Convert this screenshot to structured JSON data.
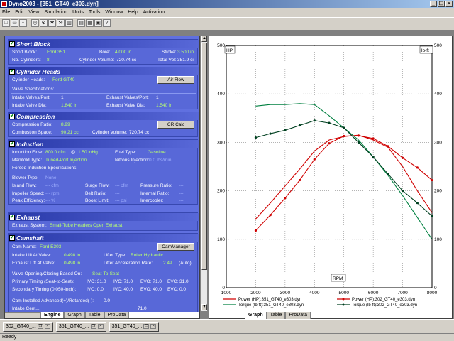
{
  "window": {
    "title": "Dyno2003 - [351_GT40_e303.dyn]"
  },
  "menu": [
    "File",
    "Edit",
    "View",
    "Simulation",
    "Units",
    "Tools",
    "Window",
    "Help",
    "Activation"
  ],
  "toolbar_icons": [
    "new-icon",
    "open-icon",
    "save-icon",
    "sep",
    "wheel-icon",
    "gear-icon",
    "settings-icon",
    "tools-icon",
    "fuel-icon",
    "sep",
    "chart-icon",
    "print-icon",
    "report-icon",
    "help-icon"
  ],
  "short_block": {
    "title": "Short Block",
    "short_block_label": "Short Block:",
    "short_block_value": "Ford 351",
    "bore_label": "Bore:",
    "bore_value": "4.000 in",
    "stroke_label": "Stroke:",
    "stroke_value": "3.500 in",
    "cylinders_label": "No. Cylinders:",
    "cylinders_value": "8",
    "cyl_volume_label": "Cylinder Volume:",
    "cyl_volume_value": "720.74 cc",
    "total_vol_label": "Total Vol:",
    "total_vol_value": "351.9 ci"
  },
  "cylinder_heads": {
    "title": "Cylinder Heads",
    "heads_label": "Cylinder Heads:",
    "heads_value": "Ford GT40",
    "air_flow_button": "Air Flow",
    "valve_spec_label": "Valve Specifications:",
    "intake_valves_label": "Intake Valves/Port:",
    "intake_valves_value": "1",
    "exhaust_valves_label": "Exhaust Valves/Port:",
    "exhaust_valves_value": "1",
    "intake_dia_label": "Intake Valve Dia:",
    "intake_dia_value": "1.840 in",
    "exhaust_dia_label": "Exhaust Valve Dia:",
    "exhaust_dia_value": "1.540 in"
  },
  "compression": {
    "title": "Compression",
    "ratio_label": "Compression Ratio:",
    "ratio_value": "8.99",
    "cr_calc_button": "CR Calc",
    "space_label": "Combustion Space:",
    "space_value": "90.21 cc",
    "cyl_volume_label": "Cylinder Volume:",
    "cyl_volume_value": "720.74 cc"
  },
  "induction": {
    "title": "Induction",
    "flow_label": "Induction Flow:",
    "flow_value": "800.0 cfm",
    "flow_at": "@",
    "flow_hg": "1.50 inHg",
    "fuel_label": "Fuel Type:",
    "fuel_value": "Gasoline",
    "manifold_label": "Manifold Type:",
    "manifold_value": "Tuned-Port Injection",
    "nitrous_label": "Nitrous Injection:",
    "nitrous_value": "0.0 lbs/min",
    "forced_label": "Forced Induction Specifications:",
    "blower_label": "Blower Type:",
    "blower_value": "None",
    "island_label": "Island Flow:",
    "island_value": "--- cfm",
    "surge_label": "Surge Flow:",
    "surge_value": "--- cfm",
    "pressure_label": "Pressure Ratio:",
    "pressure_value": "---",
    "impeller_label": "Impeller Speed:",
    "impeller_value": "--- rpm",
    "belt_label": "Belt Ratio:",
    "belt_value": "---",
    "internal_label": "Internal Ratio:",
    "internal_value": "---",
    "peak_label": "Peak Efficiency:",
    "peak_value": "--- %",
    "boost_label": "Boost Limit:",
    "boost_value": "--- psi",
    "intercooler_label": "Intercooler:",
    "intercooler_value": "---"
  },
  "exhaust": {
    "title": "Exhaust",
    "system_label": "Exhaust System:",
    "system_value": "Small-Tube Headers Open Exhaust"
  },
  "camshaft": {
    "title": "Camshaft",
    "cam_label": "Cam Name:",
    "cam_value": "Ford E303",
    "cam_button": "CamManager",
    "intake_lift_label": "Intake Lift At Valve:",
    "intake_lift_value": "0.498 in",
    "lifter_label": "Lifter Type:",
    "lifter_value": "Roller Hydraulic",
    "exhaust_lift_label": "Exhaust Lift At Valve:",
    "exhaust_lift_value": "0.498 in",
    "accel_label": "Lifter Acceleration Rate:",
    "accel_value": "2.49",
    "accel_mode": "(Auto)",
    "closing_label": "Valve Opening/Closing Based On:",
    "closing_value": "Seat-To-Seat",
    "primary_label": "Primary Timing (Seat-to-Seat):",
    "primary_ivo": "IVO: 31.0",
    "primary_ivc": "IVC: 71.0",
    "primary_evo": "EVO: 71.0",
    "primary_evc": "EVC: 31.0",
    "secondary_label": "Secondary Timing (0.050-inch):",
    "secondary_ivo": "IVO: 0.0",
    "secondary_ivc": "IVC: 40.0",
    "secondary_evo": "EVO: 40.0",
    "secondary_evc": "EVC: 0.0",
    "installed_label": "Cam Installed Advanced(+)/Retarded(-):",
    "installed_value": "0.0",
    "partial_label": "Intake Cent...",
    "partial_value": "71.0"
  },
  "left_tabs": [
    "Engine",
    "Graph",
    "Table",
    "ProData"
  ],
  "right_tabs": [
    "Graph",
    "Table",
    "ProData"
  ],
  "doc_tabs": [
    "302_GT40_...",
    "351_GT40_...",
    "351_GT40_..."
  ],
  "status": "Ready",
  "chart_data": {
    "type": "line",
    "xlabel": "RPM",
    "ylabel_left": "HP",
    "ylabel_right": "lb-ft",
    "xlim": [
      1000,
      8000
    ],
    "xticks": [
      1000,
      2000,
      3000,
      4000,
      5000,
      6000,
      7000,
      8000
    ],
    "ylim": [
      0,
      500
    ],
    "yticks": [
      0,
      100,
      200,
      300,
      400,
      500
    ],
    "grid": true,
    "legend_position": "bottom",
    "series": [
      {
        "name": "Power (HP):351_GT40_e303.dyn",
        "color": "#d00000",
        "marker": false,
        "x": [
          2000,
          2500,
          3000,
          3500,
          4000,
          4500,
          5000,
          5500,
          6000,
          6500,
          7000,
          7500,
          8000
        ],
        "y": [
          142,
          175,
          210,
          245,
          282,
          305,
          312,
          315,
          305,
          290,
          250,
          200,
          155
        ]
      },
      {
        "name": "Power (HP):302_GT40_e303.dyn",
        "color": "#d00000",
        "marker": true,
        "x": [
          2000,
          2500,
          3000,
          3500,
          4000,
          4500,
          5000,
          5500,
          6000,
          6500,
          7000,
          7500,
          8000
        ],
        "y": [
          118,
          150,
          185,
          222,
          265,
          298,
          313,
          314,
          308,
          292,
          268,
          248,
          222
        ]
      },
      {
        "name": "Torque (lb-ft):351_GT40_e303.dyn",
        "color": "#008040",
        "marker": false,
        "x": [
          2000,
          2500,
          3000,
          3500,
          4000,
          4500,
          5000,
          5500,
          6000,
          6500,
          7000,
          7500,
          8000
        ],
        "y": [
          375,
          378,
          378,
          380,
          378,
          355,
          330,
          305,
          270,
          232,
          190,
          145,
          100
        ]
      },
      {
        "name": "Torque (lb-ft):302_GT40_e303.dyn",
        "color": "#004020",
        "marker": true,
        "x": [
          2000,
          2500,
          3000,
          3500,
          4000,
          4500,
          5000,
          5500,
          6000,
          6500,
          7000,
          7500,
          8000
        ],
        "y": [
          310,
          318,
          325,
          335,
          345,
          340,
          330,
          300,
          270,
          235,
          200,
          175,
          148
        ]
      }
    ]
  }
}
